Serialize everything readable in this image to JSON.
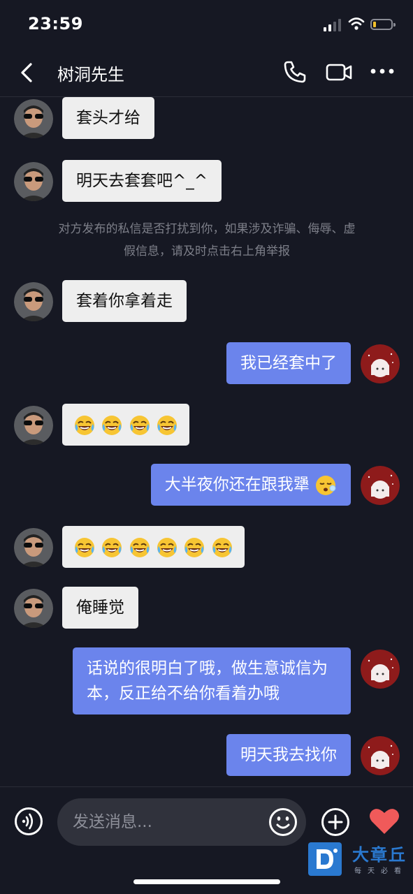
{
  "status_bar": {
    "time": "23:59"
  },
  "header": {
    "title": "树洞先生"
  },
  "notice": "对方发布的私信是否打扰到你，如果涉及诈骗、侮辱、虚假信息，请及时点击右上角举报",
  "messages": [
    {
      "side": "in",
      "text": "套头才给"
    },
    {
      "side": "in",
      "text": "明天去套套吧^_^"
    },
    {
      "side": "in",
      "text": "套着你拿着走"
    },
    {
      "side": "out",
      "text": "我已经套中了"
    },
    {
      "side": "in",
      "text": "",
      "emoji": [
        "rofl-emoji",
        "rofl-emoji",
        "rofl-emoji",
        "rofl-emoji"
      ]
    },
    {
      "side": "out",
      "text": "大半夜你还在跟我犟",
      "emoji": [
        "sleeping-emoji"
      ]
    },
    {
      "side": "in",
      "text": "",
      "emoji": [
        "rofl-emoji",
        "rofl-emoji",
        "rofl-emoji",
        "rofl-emoji",
        "rofl-emoji",
        "rofl-emoji"
      ]
    },
    {
      "side": "in",
      "text": "俺睡觉"
    },
    {
      "side": "out",
      "text": "话说的很明白了哦，做生意诚信为本，反正给不给你看着办哦"
    },
    {
      "side": "out",
      "text": "明天我去找你"
    }
  ],
  "input": {
    "placeholder": "发送消息..."
  },
  "icons": {
    "back": "back-chevron-icon",
    "call": "phone-icon",
    "video": "video-camera-icon",
    "more": "more-dots-icon",
    "voice": "voice-icon",
    "emoji": "emoji-icon",
    "plus": "plus-icon",
    "heart": "heart-icon"
  },
  "watermark": {
    "name": "大章丘",
    "tagline": "每天必看"
  },
  "colors": {
    "background": "#161823",
    "incoming_bubble": "#eeeeee",
    "outgoing_bubble": "#6b84ec",
    "heart": "#f05a5a",
    "watermark": "#2a79d0"
  }
}
